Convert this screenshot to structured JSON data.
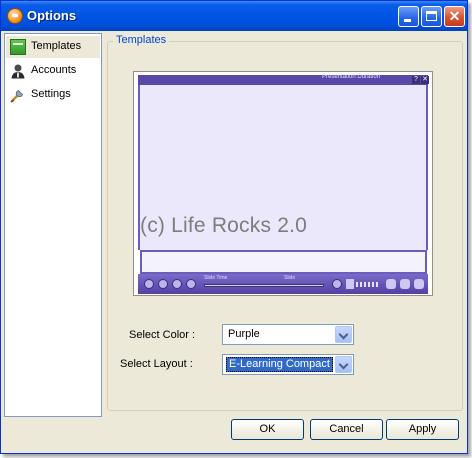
{
  "window": {
    "title": "Options"
  },
  "sidebar": {
    "items": [
      {
        "label": "Templates",
        "icon": "template-icon",
        "selected": true
      },
      {
        "label": "Accounts",
        "icon": "user-icon",
        "selected": false
      },
      {
        "label": "Settings",
        "icon": "settings-wrench-icon",
        "selected": false
      }
    ]
  },
  "panel": {
    "legend": "Templates",
    "preview": {
      "header_text": "Presentation Duration",
      "time_label": "Slide Time",
      "slide_label": "Slide",
      "help_glyph": "?",
      "close_glyph": "✕",
      "theme_color": "#5a48a8"
    },
    "watermark": "(c) Life Rocks 2.0",
    "color": {
      "label": "Select Color :",
      "value": "Purple"
    },
    "layout": {
      "label": "Select Layout :",
      "value": "E-Learning Compact"
    }
  },
  "buttons": {
    "ok": "OK",
    "cancel": "Cancel",
    "apply": "Apply"
  },
  "titlebar_controls": {
    "close_glyph": "✕"
  }
}
